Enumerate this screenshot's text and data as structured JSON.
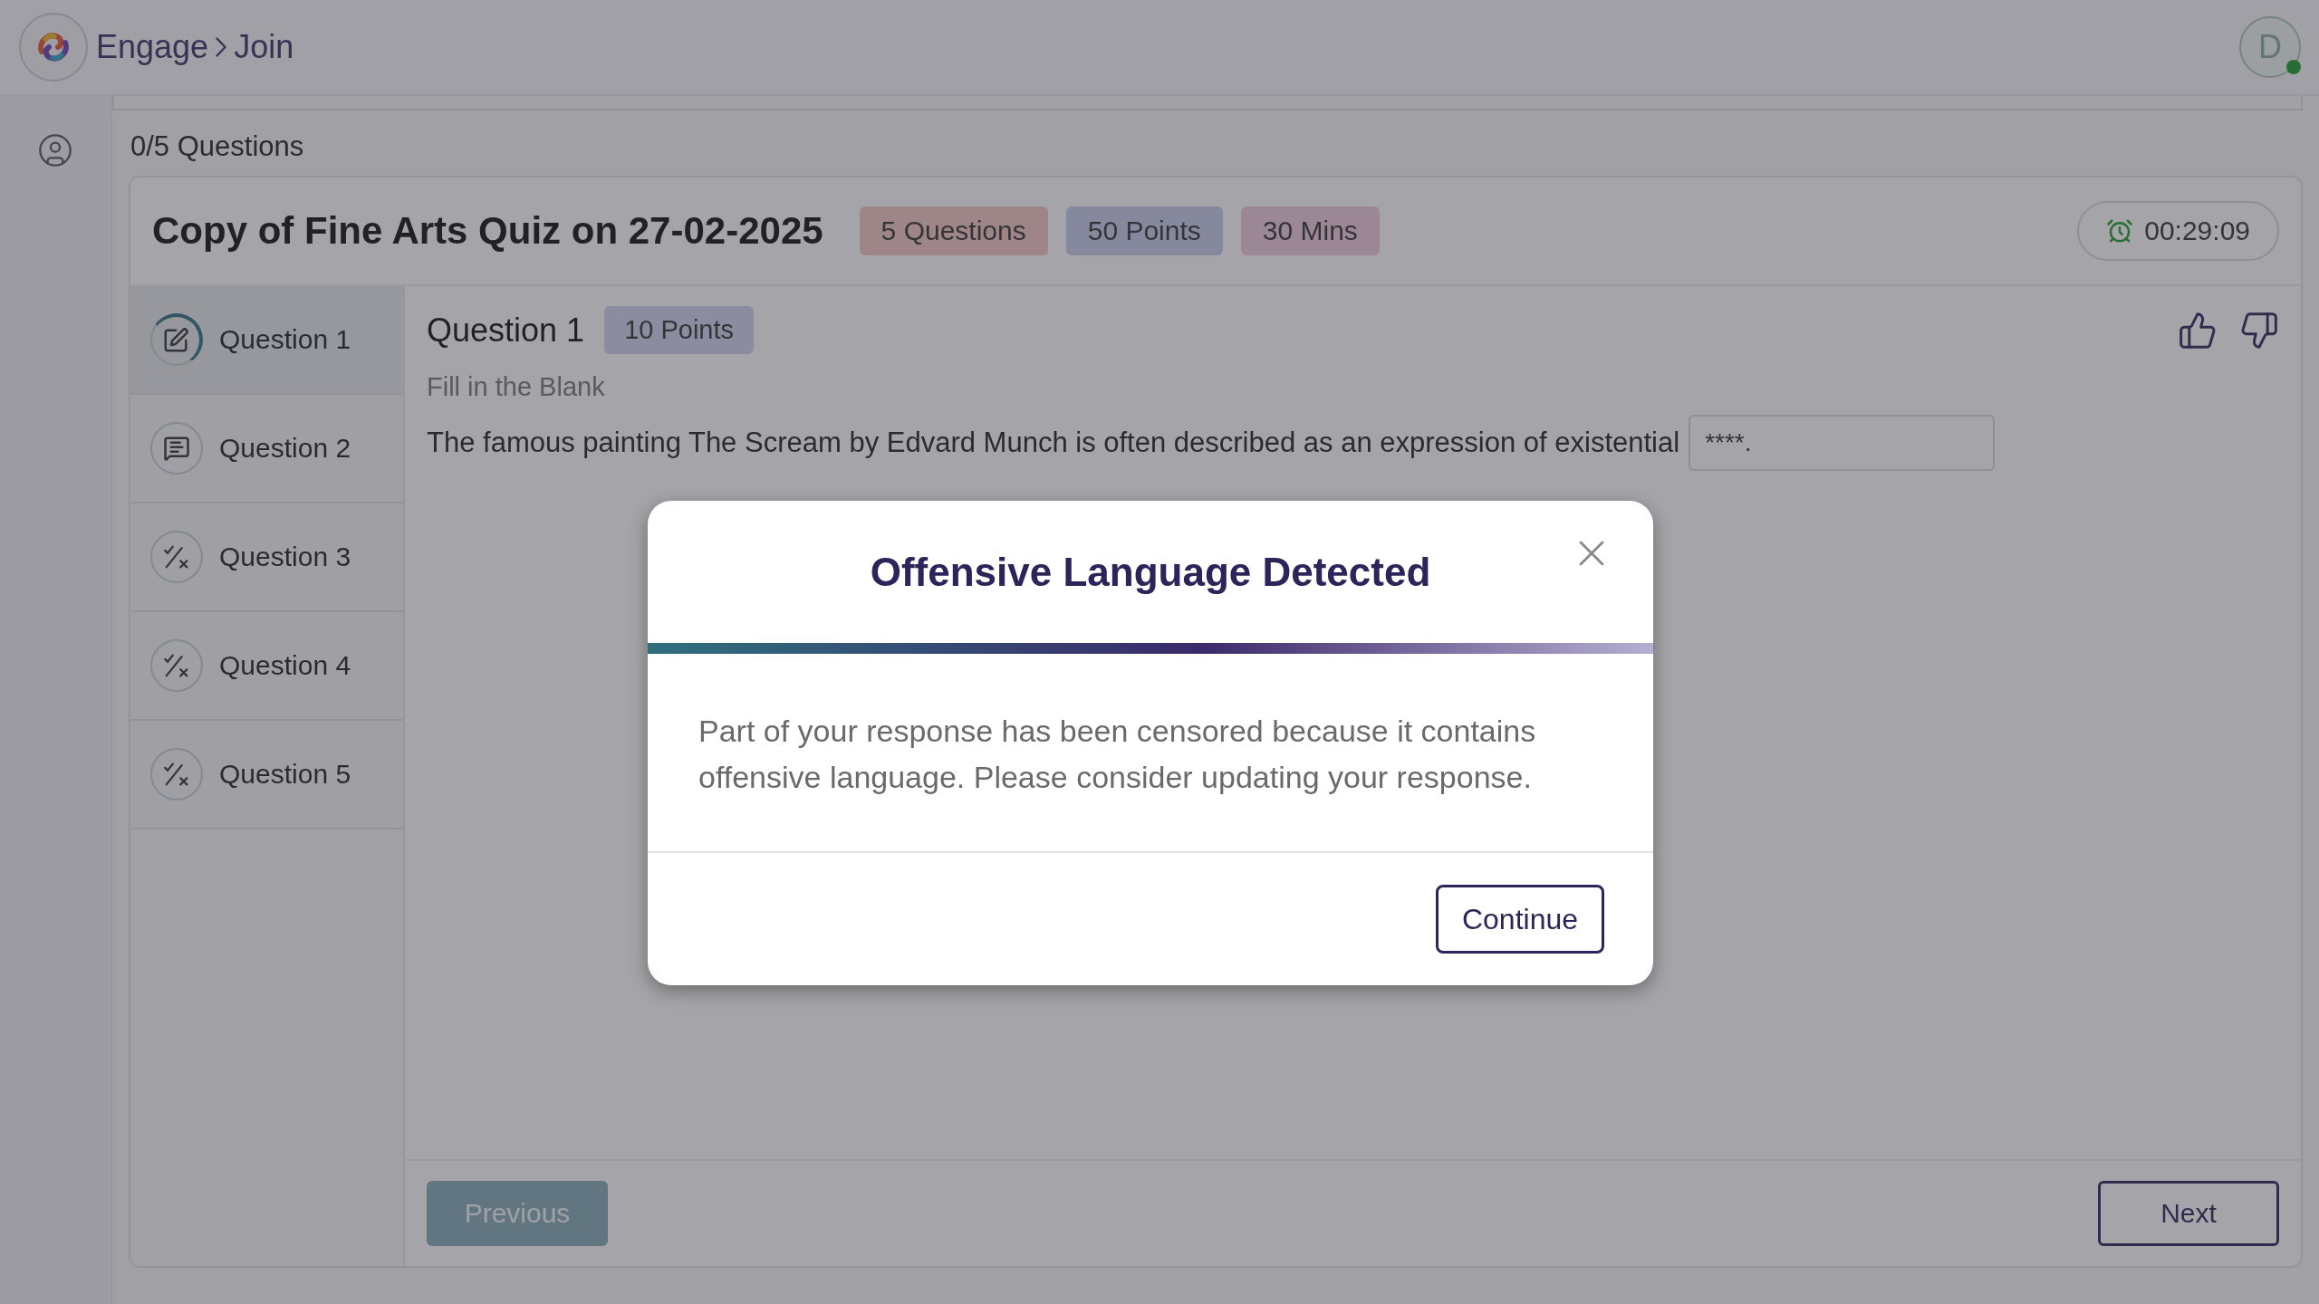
{
  "header": {
    "breadcrumb": [
      "Engage",
      "Join"
    ],
    "user": {
      "initial": "D",
      "online": true
    }
  },
  "progress": {
    "label": "0/5 Questions"
  },
  "quiz": {
    "title": "Copy of Fine Arts Quiz on 27-02-2025",
    "chips": [
      {
        "label": "5 Questions",
        "kind": "count"
      },
      {
        "label": "50 Points",
        "kind": "points"
      },
      {
        "label": "30 Mins",
        "kind": "time"
      }
    ],
    "timer": "00:29:09",
    "questions": [
      {
        "label": "Question 1",
        "kind": "fill",
        "selected": true
      },
      {
        "label": "Question 2",
        "kind": "short",
        "selected": false
      },
      {
        "label": "Question 3",
        "kind": "truefalse",
        "selected": false
      },
      {
        "label": "Question 4",
        "kind": "truefalse",
        "selected": false
      },
      {
        "label": "Question 5",
        "kind": "truefalse",
        "selected": false
      }
    ],
    "current": {
      "title": "Question 1",
      "points": "10 Points",
      "type": "Fill in the Blank",
      "text": "The famous painting The Scream by Edvard Munch is often described as an expression of existential",
      "answer": "****."
    },
    "previous": "Previous",
    "next": "Next"
  },
  "dialog": {
    "title": "Offensive Language Detected",
    "message": "Part of your response has been censored because it contains offensive language. Please consider updating your response.",
    "button": "Continue"
  }
}
